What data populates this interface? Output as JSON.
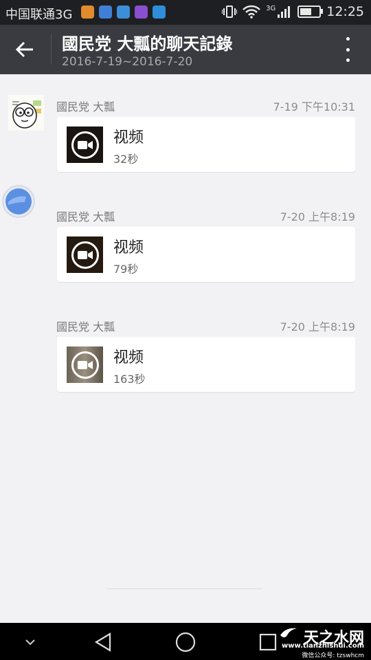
{
  "status_bar": {
    "carrier": "中国联通3G",
    "network": "3G",
    "time": "12:25",
    "app_icons": [
      {
        "icon": "notification-app-icon",
        "color": "#e08b2c"
      },
      {
        "icon": "notification-app-icon",
        "color": "#3f7fd8"
      },
      {
        "icon": "notification-app-icon",
        "color": "#3c8ed8"
      },
      {
        "icon": "notification-app-icon",
        "color": "#8a4fd0"
      },
      {
        "icon": "notification-app-icon",
        "color": "#2f8ed9"
      }
    ]
  },
  "header": {
    "title": "國民党 大瓢的聊天記錄",
    "date_range": "2016-7-19~2016-7-20"
  },
  "messages": [
    {
      "sender": "國民党 大瓢",
      "time": "7-19 下午10:31",
      "type": "视频",
      "duration": "32秒"
    },
    {
      "sender": "國民党 大瓢",
      "time": "7-20 上午8:19",
      "type": "视频",
      "duration": "79秒"
    },
    {
      "sender": "國民党 大瓢",
      "time": "7-20 上午8:19",
      "type": "视频",
      "duration": "163秒"
    }
  ],
  "watermark": {
    "brand": "天之水网",
    "url": "www.tianzhishui.com",
    "account": "微信公众号: tzswhcm"
  },
  "colors": {
    "status_bar_bg": "#1e1f22",
    "title_bar_bg": "#3a3b40",
    "page_bg": "#f2f1f4",
    "card_bg": "#ffffff"
  }
}
